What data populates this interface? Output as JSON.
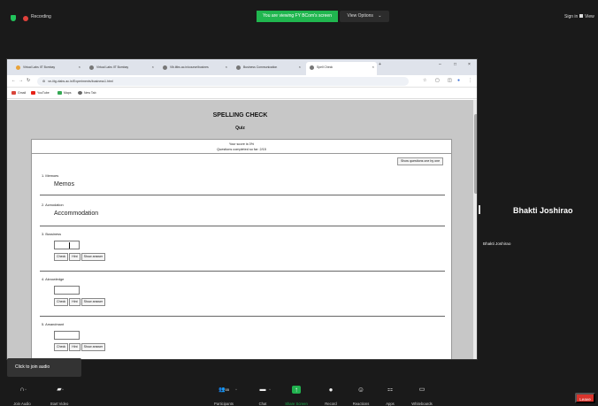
{
  "zoom_top": {
    "recording_label": "Recording",
    "share_banner": "You are viewing FY BCom's screen",
    "view_options_label": "View Options",
    "view_options_caret": "⌄",
    "signin_label": "Sign in",
    "view_label": "View"
  },
  "browser": {
    "tabs": [
      {
        "label": "Virtual Labs IIT Bombay"
      },
      {
        "label": "Virtual Labs IIT Bombay"
      },
      {
        "label": "Vlb.iitbs.ac.in/course/busines"
      },
      {
        "label": "Business Communication"
      },
      {
        "label": "Spell Check"
      }
    ],
    "new_tab_glyph": "+",
    "close_glyph": "×",
    "minimize_glyph": "–",
    "restore_glyph": "□",
    "window_close_glyph": "×",
    "url": "ve-iitg.vlabs.ac.in/Experiments/business1.html",
    "bookmarks": [
      {
        "label": "Gmail",
        "color": "#d8453a"
      },
      {
        "label": "YouTube",
        "color": "#e62117"
      },
      {
        "label": "Maps",
        "color": "#34a853"
      },
      {
        "label": "New Tab",
        "color": "#666666"
      }
    ]
  },
  "page": {
    "title": "SPELLING CHECK",
    "subtitle": "Quiz",
    "score_text": "Your score is 0%",
    "completed_text": "Questions completed so far: 2/15",
    "show_one_by_one": "Show questions one by one",
    "questions": [
      {
        "number_word": "1.   Memoes",
        "answer": "Memos"
      },
      {
        "number_word": "2.   Acmodation",
        "answer": "Accommodation"
      },
      {
        "number_word": "3.   Bussiness"
      },
      {
        "number_word": "4.   Aknowledge"
      },
      {
        "number_word": "5.   Amandmant"
      }
    ],
    "buttons": {
      "check": "Check",
      "hint": "Hint",
      "show_answer": "Show answer"
    }
  },
  "participants": {
    "active_speaker": "Bhakti Joshirao",
    "thumbnail_name": "Bhakti Joshirao"
  },
  "tooltip": {
    "text": "Click to join audio"
  },
  "toolbar": {
    "items": [
      {
        "label": "Join Audio",
        "icon": "🎧"
      },
      {
        "label": "Start Video",
        "icon": "■"
      },
      {
        "label": "Participants",
        "icon": "👥",
        "count": "55"
      },
      {
        "label": "Chat",
        "icon": "💬"
      },
      {
        "label": "Share Screen",
        "icon": "↑"
      },
      {
        "label": "Record",
        "icon": "●"
      },
      {
        "label": "Reactions",
        "icon": "☺"
      },
      {
        "label": "Apps",
        "icon": "⚏"
      },
      {
        "label": "Whiteboards",
        "icon": "▭"
      }
    ],
    "caret": "^",
    "leave_label": "Leave"
  },
  "colors": {
    "share_green": "#20b64f",
    "leave_red": "#d9342c",
    "page_gray": "#c7c7c7"
  }
}
